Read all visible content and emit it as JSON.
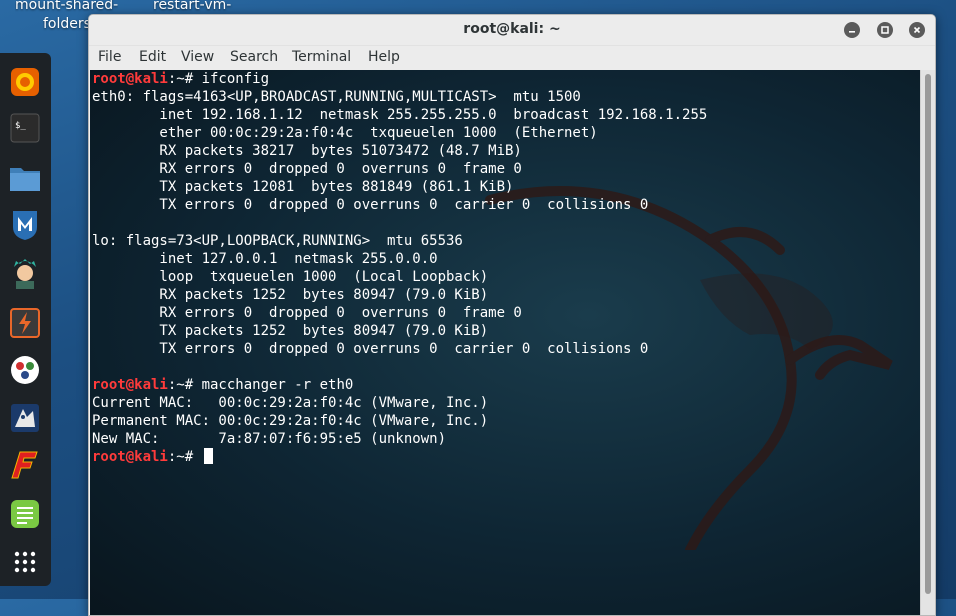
{
  "desktop": {
    "icons": [
      {
        "label_line1": "mount-shared-",
        "label_line2": "folders"
      },
      {
        "label_line1": "restart-vm-"
      }
    ]
  },
  "dock": {
    "items": [
      {
        "name": "firefox-icon",
        "color": "#e66000"
      },
      {
        "name": "terminal-icon",
        "color": "#2b2b2b"
      },
      {
        "name": "files-icon",
        "color": "#4a90c8"
      },
      {
        "name": "metasploit-icon",
        "color": "#2a6fb4"
      },
      {
        "name": "armitage-icon",
        "color": "#3c9a8a"
      },
      {
        "name": "burpsuite-icon",
        "color": "#e8672a"
      },
      {
        "name": "maltego-icon",
        "color": "#ffffff"
      },
      {
        "name": "beef-icon",
        "color": "#2a4a8a"
      },
      {
        "name": "faraday-icon",
        "color": "#e02020"
      },
      {
        "name": "leafpad-icon",
        "color": "#7ac943"
      },
      {
        "name": "show-apps-icon",
        "color": "#ffffff"
      }
    ]
  },
  "window": {
    "title": "root@kali: ~",
    "menu": [
      "File",
      "Edit",
      "View",
      "Search",
      "Terminal",
      "Help"
    ]
  },
  "terminal": {
    "prompt_user": "root@kali",
    "prompt_suffix": ":~# ",
    "lines": [
      {
        "type": "prompt",
        "text": "ifconfig"
      },
      {
        "type": "out",
        "text": "eth0: flags=4163<UP,BROADCAST,RUNNING,MULTICAST>  mtu 1500"
      },
      {
        "type": "out",
        "text": "        inet 192.168.1.12  netmask 255.255.255.0  broadcast 192.168.1.255"
      },
      {
        "type": "out",
        "text": "        ether 00:0c:29:2a:f0:4c  txqueuelen 1000  (Ethernet)"
      },
      {
        "type": "out",
        "text": "        RX packets 38217  bytes 51073472 (48.7 MiB)"
      },
      {
        "type": "out",
        "text": "        RX errors 0  dropped 0  overruns 0  frame 0"
      },
      {
        "type": "out",
        "text": "        TX packets 12081  bytes 881849 (861.1 KiB)"
      },
      {
        "type": "out",
        "text": "        TX errors 0  dropped 0 overruns 0  carrier 0  collisions 0"
      },
      {
        "type": "out",
        "text": ""
      },
      {
        "type": "out",
        "text": "lo: flags=73<UP,LOOPBACK,RUNNING>  mtu 65536"
      },
      {
        "type": "out",
        "text": "        inet 127.0.0.1  netmask 255.0.0.0"
      },
      {
        "type": "out",
        "text": "        loop  txqueuelen 1000  (Local Loopback)"
      },
      {
        "type": "out",
        "text": "        RX packets 1252  bytes 80947 (79.0 KiB)"
      },
      {
        "type": "out",
        "text": "        RX errors 0  dropped 0  overruns 0  frame 0"
      },
      {
        "type": "out",
        "text": "        TX packets 1252  bytes 80947 (79.0 KiB)"
      },
      {
        "type": "out",
        "text": "        TX errors 0  dropped 0 overruns 0  carrier 0  collisions 0"
      },
      {
        "type": "out",
        "text": ""
      },
      {
        "type": "prompt",
        "text": "macchanger -r eth0"
      },
      {
        "type": "out",
        "text": "Current MAC:   00:0c:29:2a:f0:4c (VMware, Inc.)"
      },
      {
        "type": "out",
        "text": "Permanent MAC: 00:0c:29:2a:f0:4c (VMware, Inc.)"
      },
      {
        "type": "out",
        "text": "New MAC:       7a:87:07:f6:95:e5 (unknown)"
      },
      {
        "type": "prompt-cursor",
        "text": ""
      }
    ]
  },
  "colors": {
    "prompt_user": "#ff3b3b",
    "terminal_text": "#ffffff"
  }
}
